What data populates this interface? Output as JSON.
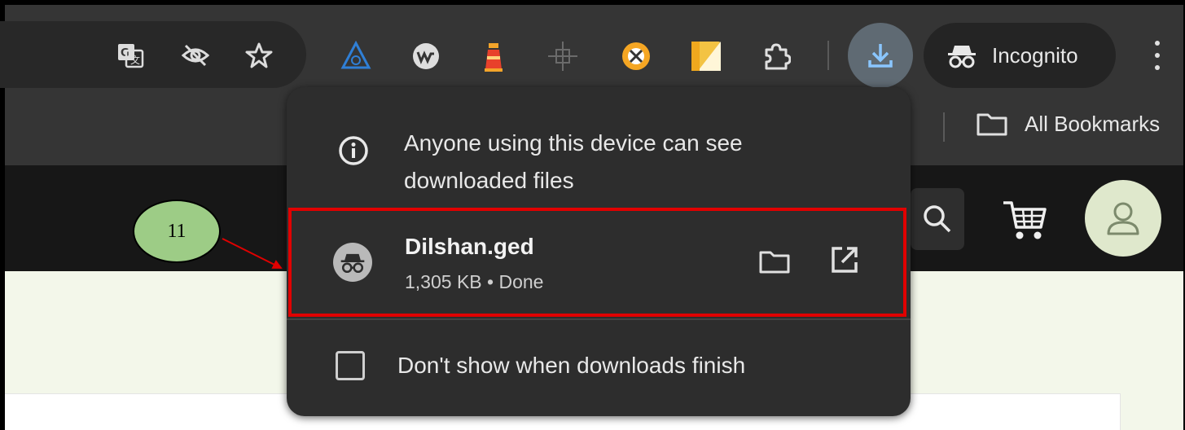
{
  "toolbar": {
    "incognito_label": "Incognito",
    "extensions": [
      "translate-icon",
      "tracking-eye-icon",
      "star-icon",
      "triangle-extension-icon",
      "w-extension-icon",
      "lighthouse-extension-icon",
      "crosshair-extension-icon",
      "orange-extension-icon",
      "notes-extension-icon",
      "puzzle-extensions-icon"
    ]
  },
  "bookmarks": {
    "all_bookmarks_label": "All Bookmarks"
  },
  "downloads_popup": {
    "notice": "Anyone using this device can see downloaded files",
    "item": {
      "filename": "Dilshan.ged",
      "status": "1,305 KB • Done"
    },
    "option_label": "Don't show when downloads finish"
  },
  "annotation": {
    "step_number": "11"
  },
  "colors": {
    "toolbar_bg": "#353535",
    "popup_bg": "#2d2d2d",
    "highlight": "#e00000",
    "callout_fill": "#9dcc86",
    "page_bg": "#f3f7ea"
  }
}
